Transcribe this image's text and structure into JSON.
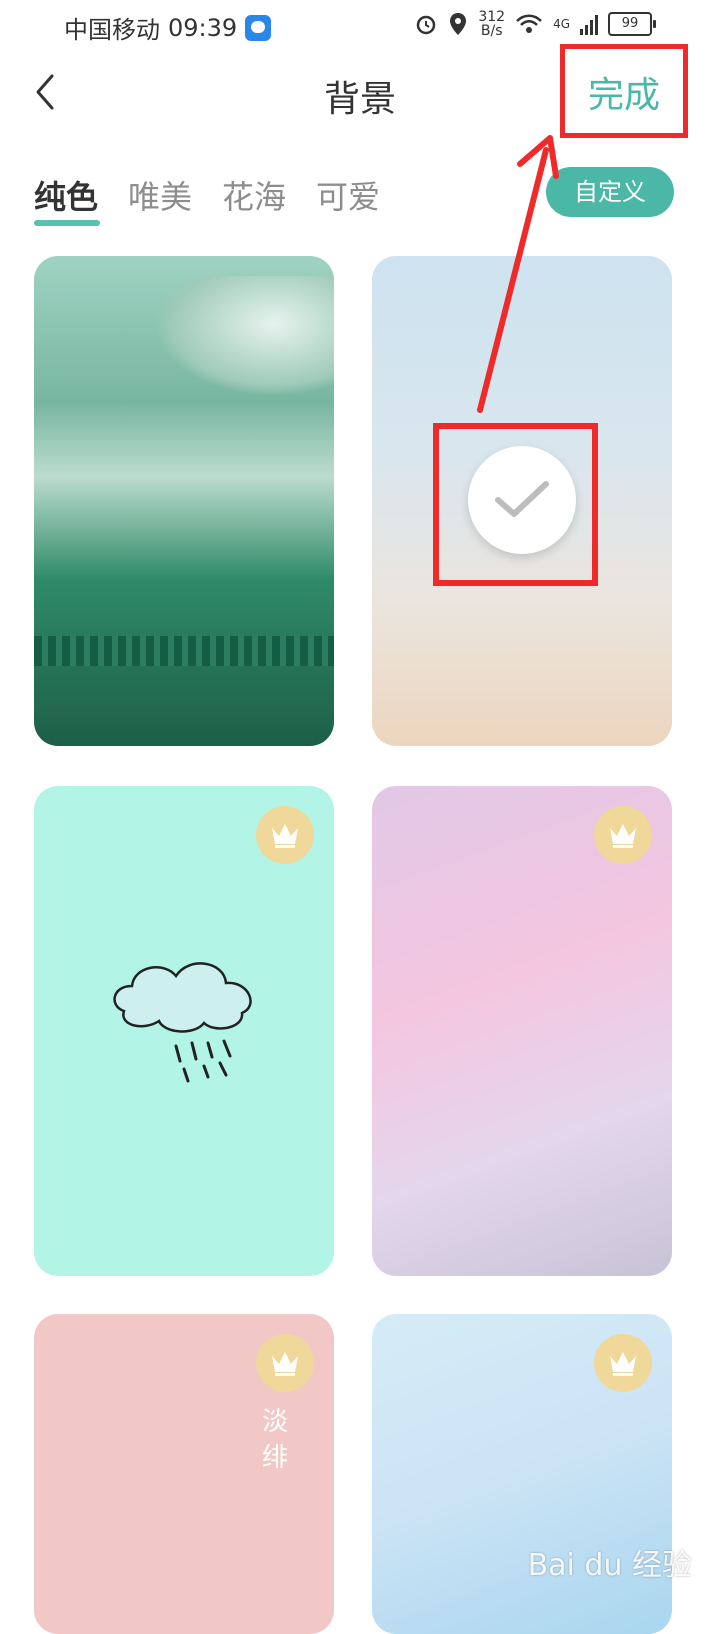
{
  "status_bar": {
    "carrier": "中国移动",
    "time": "09:39",
    "speed_top": "312",
    "speed_bottom": "B/s",
    "network": "4G",
    "battery": "99"
  },
  "header": {
    "title": "背景",
    "done_label": "完成"
  },
  "tabs": [
    {
      "label": "纯色",
      "active": true
    },
    {
      "label": "唯美",
      "active": false
    },
    {
      "label": "花海",
      "active": false
    },
    {
      "label": "可爱",
      "active": false
    }
  ],
  "custom_button": "自定义",
  "cards": [
    {
      "name": "mist-forest",
      "selected": false,
      "premium": false
    },
    {
      "name": "pastel-sky",
      "selected": true,
      "premium": false
    },
    {
      "name": "mint-rain-cloud",
      "selected": false,
      "premium": true
    },
    {
      "name": "pink-watercolor",
      "selected": false,
      "premium": true
    },
    {
      "name": "blush-pink",
      "selected": false,
      "premium": true,
      "text": "淡绯"
    },
    {
      "name": "blue-sky",
      "selected": false,
      "premium": true
    }
  ],
  "watermark": "Bai du 经验",
  "colors": {
    "accent": "#4bb7a6",
    "highlight": "#ee2a2a",
    "crown_bg": "#f0d79a"
  },
  "icons": [
    "back-icon",
    "check-icon",
    "crown-icon",
    "wifi-icon",
    "alarm-icon",
    "location-icon"
  ]
}
